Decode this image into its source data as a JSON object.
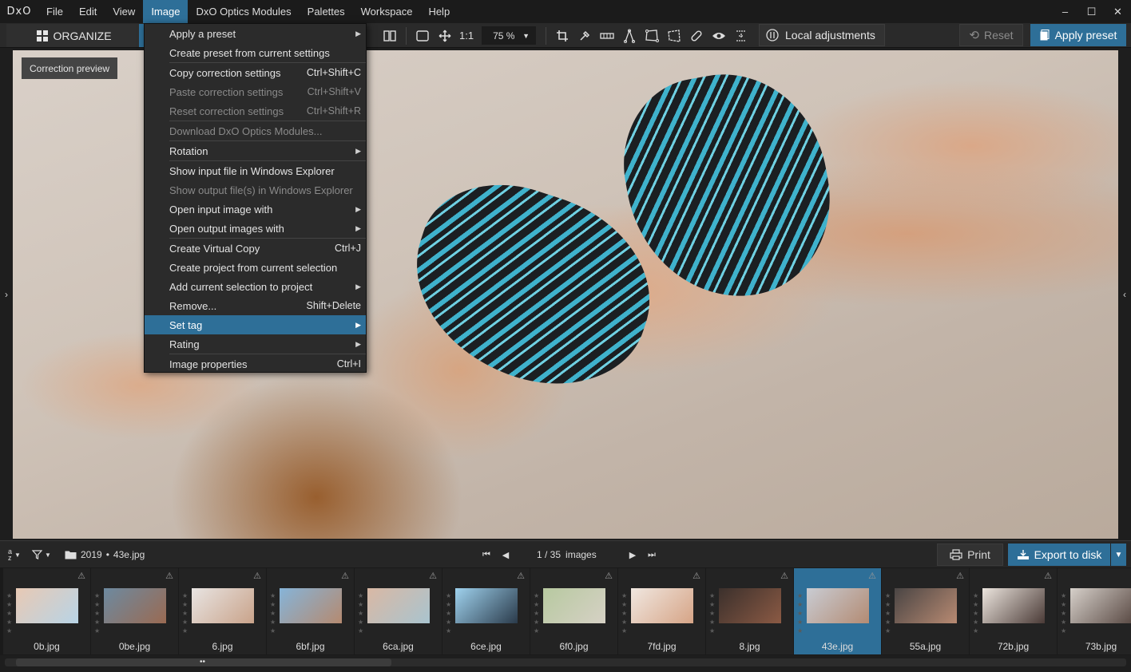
{
  "app": {
    "logo": "DxO"
  },
  "menubar": {
    "items": [
      "File",
      "Edit",
      "View",
      "Image",
      "DxO Optics Modules",
      "Palettes",
      "Workspace",
      "Help"
    ],
    "active": "Image"
  },
  "window_controls": {
    "minimize": "–",
    "maximize": "☐",
    "close": "✕"
  },
  "toolbar": {
    "organize_label": "ORGANIZE",
    "one_to_one": "1:1",
    "zoom_value": "75 %",
    "local_adjustments_label": "Local adjustments",
    "reset_label": "Reset",
    "apply_preset_label": "Apply preset"
  },
  "viewer": {
    "correction_preview_label": "Correction preview"
  },
  "image_menu": {
    "items": [
      {
        "label": "Apply a preset",
        "shortcut": "",
        "submenu": true,
        "disabled": false
      },
      {
        "label": "Create preset from current settings",
        "shortcut": "",
        "submenu": false,
        "disabled": false
      },
      {
        "label": "Copy correction settings",
        "shortcut": "Ctrl+Shift+C",
        "submenu": false,
        "disabled": false
      },
      {
        "label": "Paste correction settings",
        "shortcut": "Ctrl+Shift+V",
        "submenu": false,
        "disabled": true
      },
      {
        "label": "Reset correction settings",
        "shortcut": "Ctrl+Shift+R",
        "submenu": false,
        "disabled": true
      },
      {
        "label": "Download DxO Optics Modules...",
        "shortcut": "",
        "submenu": false,
        "disabled": true
      },
      {
        "label": "Rotation",
        "shortcut": "",
        "submenu": true,
        "disabled": false
      },
      {
        "label": "Show input file in Windows Explorer",
        "shortcut": "",
        "submenu": false,
        "disabled": false
      },
      {
        "label": "Show output file(s) in Windows Explorer",
        "shortcut": "",
        "submenu": false,
        "disabled": true
      },
      {
        "label": "Open input image with",
        "shortcut": "",
        "submenu": true,
        "disabled": false
      },
      {
        "label": "Open output images with",
        "shortcut": "",
        "submenu": true,
        "disabled": false
      },
      {
        "label": "Create Virtual Copy",
        "shortcut": "Ctrl+J",
        "submenu": false,
        "disabled": false
      },
      {
        "label": "Create project from current selection",
        "shortcut": "",
        "submenu": false,
        "disabled": false
      },
      {
        "label": "Add current selection to project",
        "shortcut": "",
        "submenu": true,
        "disabled": false
      },
      {
        "label": "Remove...",
        "shortcut": "Shift+Delete",
        "submenu": false,
        "disabled": false
      },
      {
        "label": "Set tag",
        "shortcut": "",
        "submenu": true,
        "disabled": false
      },
      {
        "label": "Rating",
        "shortcut": "",
        "submenu": true,
        "disabled": false
      },
      {
        "label": "Image properties",
        "shortcut": "Ctrl+I",
        "submenu": false,
        "disabled": false
      }
    ],
    "highlighted": "Set tag"
  },
  "filmstrip_bar": {
    "folder_path": "2019",
    "bullet": "•",
    "current_file": "43e.jpg",
    "position": "1 / 35",
    "count_label": "images",
    "print_label": "Print",
    "export_label": "Export to disk"
  },
  "thumbnails": [
    {
      "name": "0b.jpg",
      "selected": false
    },
    {
      "name": "0be.jpg",
      "selected": false
    },
    {
      "name": "6.jpg",
      "selected": false
    },
    {
      "name": "6bf.jpg",
      "selected": false
    },
    {
      "name": "6ca.jpg",
      "selected": false
    },
    {
      "name": "6ce.jpg",
      "selected": false
    },
    {
      "name": "6f0.jpg",
      "selected": false
    },
    {
      "name": "7fd.jpg",
      "selected": false
    },
    {
      "name": "8.jpg",
      "selected": false
    },
    {
      "name": "43e.jpg",
      "selected": true
    },
    {
      "name": "55a.jpg",
      "selected": false
    },
    {
      "name": "72b.jpg",
      "selected": false
    },
    {
      "name": "73b.jpg",
      "selected": false
    }
  ],
  "colors": {
    "accent": "#2e6f98",
    "background": "#1e1e1e",
    "menu_bg": "#2b2b2b"
  }
}
